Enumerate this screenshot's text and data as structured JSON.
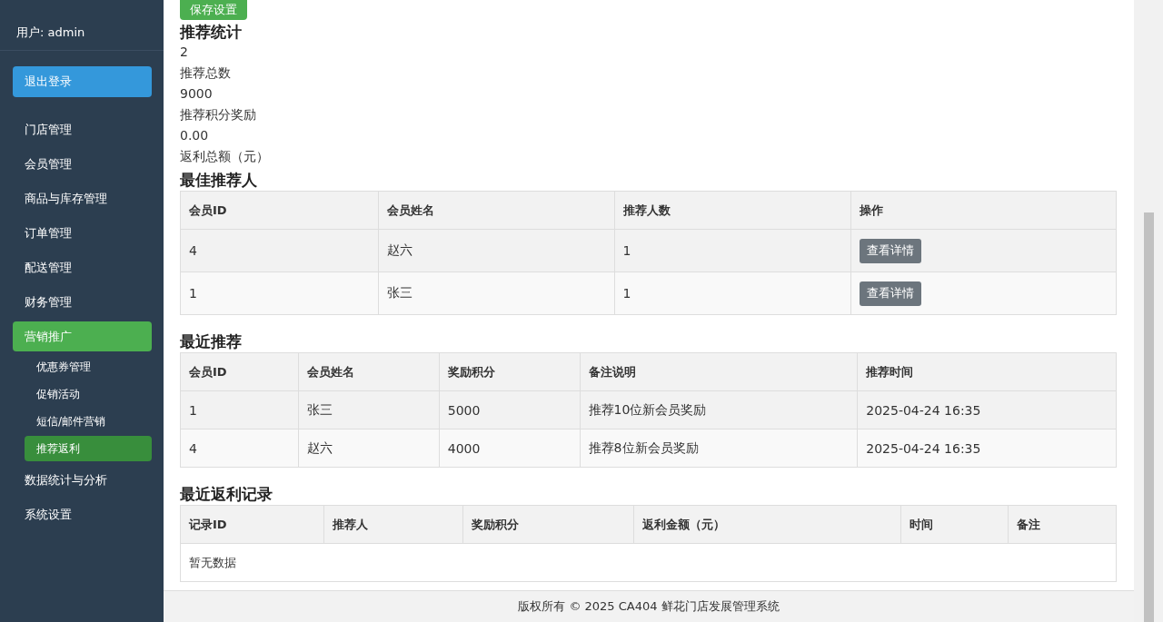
{
  "sidebar": {
    "user": "用户: admin",
    "logout": "退出登录",
    "items": [
      {
        "label": "门店管理",
        "selected": false
      },
      {
        "label": "会员管理",
        "selected": false
      },
      {
        "label": "商品与库存管理",
        "selected": false
      },
      {
        "label": "订单管理",
        "selected": false
      },
      {
        "label": "配送管理",
        "selected": false
      },
      {
        "label": "财务管理",
        "selected": false
      },
      {
        "label": "营销推广",
        "selected": true,
        "children": [
          {
            "label": "优惠券管理",
            "selected": false
          },
          {
            "label": "促销活动",
            "selected": false
          },
          {
            "label": "短信/邮件营销",
            "selected": false
          },
          {
            "label": "推荐返利",
            "selected": true
          }
        ]
      },
      {
        "label": "数据统计与分析",
        "selected": false
      },
      {
        "label": "系统设置",
        "selected": false
      }
    ]
  },
  "save_button": "保存设置",
  "stats": {
    "title": "推荐统计",
    "items": [
      {
        "value": "2",
        "label": "推荐总数"
      },
      {
        "value": "9000",
        "label": "推荐积分奖励"
      },
      {
        "value": "0.00",
        "label": "返利总额（元）"
      }
    ]
  },
  "tables": [
    {
      "title": "最佳推荐人",
      "columns": [
        "会员ID",
        "会员姓名",
        "推荐人数",
        "操作"
      ],
      "rows": [
        {
          "cells": [
            "4",
            "赵六",
            "1"
          ],
          "action": "查看详情"
        },
        {
          "cells": [
            "1",
            "张三",
            "1"
          ],
          "action": "查看详情"
        }
      ]
    },
    {
      "title": "最近推荐",
      "columns": [
        "会员ID",
        "会员姓名",
        "奖励积分",
        "备注说明",
        "推荐时间"
      ],
      "rows": [
        {
          "cells": [
            "1",
            "张三",
            "5000",
            "推荐10位新会员奖励",
            "2025-04-24 16:35"
          ]
        },
        {
          "cells": [
            "4",
            "赵六",
            "4000",
            "推荐8位新会员奖励",
            "2025-04-24 16:35"
          ]
        }
      ]
    },
    {
      "title": "最近返利记录",
      "columns": [
        "记录ID",
        "推荐人",
        "奖励积分",
        "返利金额（元）",
        "时间",
        "备注"
      ],
      "empty": "暂无数据"
    }
  ],
  "footer": "版权所有 © 2025 CA404 鲜花门店发展管理系统"
}
